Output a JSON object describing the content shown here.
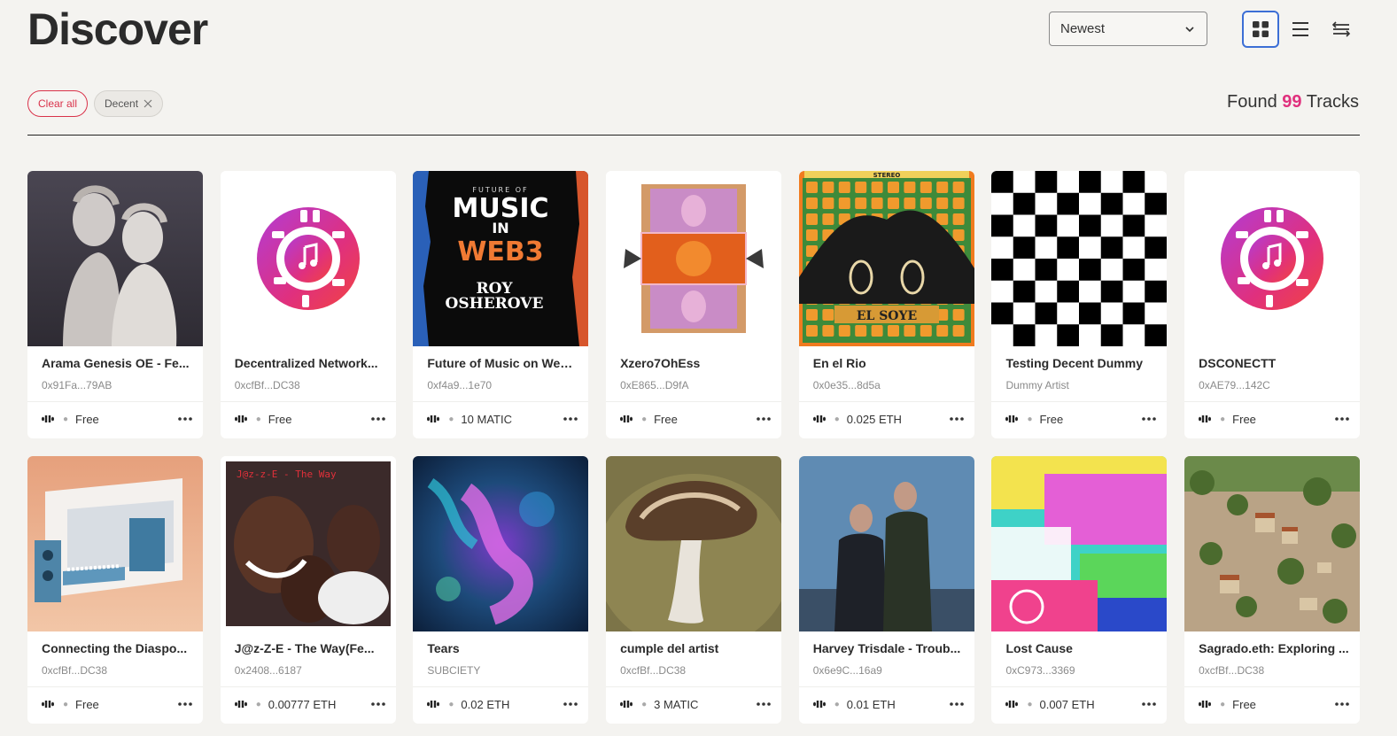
{
  "header": {
    "title": "Discover",
    "sort": {
      "selected": "Newest"
    },
    "views": [
      {
        "name": "grid-view-icon",
        "active": true
      },
      {
        "name": "list-view-icon",
        "active": false
      },
      {
        "name": "compact-view-icon",
        "active": false
      }
    ]
  },
  "filters": {
    "clear_label": "Clear all",
    "active": [
      {
        "label": "Decent"
      }
    ]
  },
  "results": {
    "prefix": "Found",
    "count": "99",
    "suffix": "Tracks"
  },
  "colors": {
    "accent": "#e0307d",
    "clear": "#d9324a",
    "active_view": "#3c6fd6"
  },
  "tracks": [
    {
      "title": "Arama Genesis OE - Fe...",
      "artist": "0x91Fa...79AB",
      "price": "Free",
      "art": "statues"
    },
    {
      "title": "Decentralized Network...",
      "artist": "0xcfBf...DC38",
      "price": "Free",
      "art": "logo"
    },
    {
      "title": "Future of Music on Web...",
      "artist": "0xf4a9...1e70",
      "price": "10 MATIC",
      "art": "poster"
    },
    {
      "title": "Xzero7OhEss",
      "artist": "0xE865...D9fA",
      "price": "Free",
      "art": "kaleido"
    },
    {
      "title": "En el Rio",
      "artist": "0x0e35...8d5a",
      "price": "0.025 ETH",
      "art": "elsoye"
    },
    {
      "title": "Testing Decent Dummy",
      "artist": "Dummy Artist",
      "price": "Free",
      "art": "checker"
    },
    {
      "title": "DSCONECTT",
      "artist": "0xAE79...142C",
      "price": "Free",
      "art": "logo"
    },
    {
      "title": "Connecting the Diaspo...",
      "artist": "0xcfBf...DC38",
      "price": "Free",
      "art": "studio"
    },
    {
      "title": "J@z-Z-E - The Way(Fe...",
      "artist": "0x2408...6187",
      "price": "0.00777 ETH",
      "art": "faces"
    },
    {
      "title": "Tears",
      "artist": "SUBCIETY",
      "price": "0.02 ETH",
      "art": "tears"
    },
    {
      "title": "cumple del artist",
      "artist": "0xcfBf...DC38",
      "price": "3 MATIC",
      "art": "mushroom"
    },
    {
      "title": "Harvey Trisdale - Troub...",
      "artist": "0x6e9C...16a9",
      "price": "0.01 ETH",
      "art": "duo"
    },
    {
      "title": "Lost Cause",
      "artist": "0xC973...3369",
      "price": "0.007 ETH",
      "art": "glitch"
    },
    {
      "title": "Sagrado.eth: Exploring ...",
      "artist": "0xcfBf...DC38",
      "price": "Free",
      "art": "village"
    }
  ],
  "card_labels": {
    "poster_line1": "FUTURE OF",
    "poster_line2": "MUSIC",
    "poster_line3": "IN",
    "poster_line4": "WEB3",
    "poster_line5": "ROY",
    "poster_line6": "OSHEROVE",
    "elsoye": "EL SOYE",
    "stereo": "STEREO"
  }
}
